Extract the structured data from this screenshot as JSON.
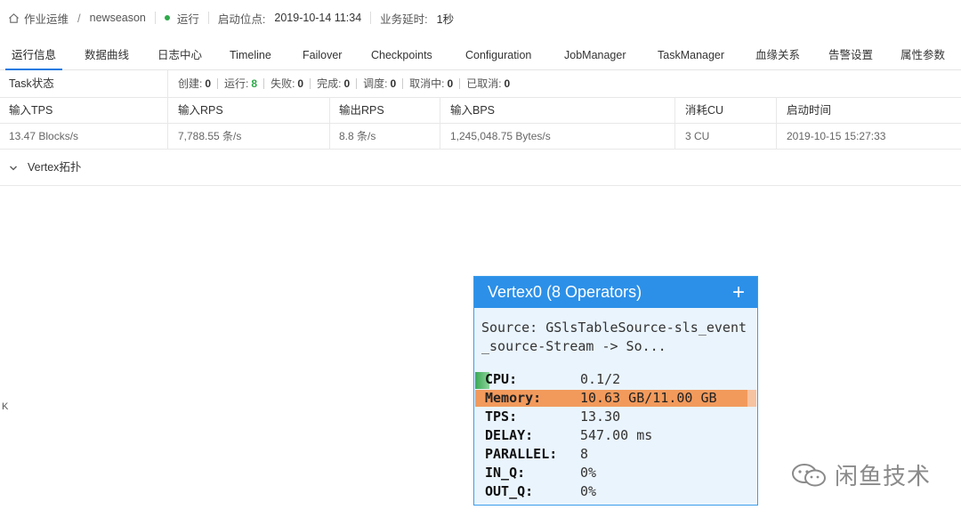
{
  "breadcrumb": {
    "root": "作业运维",
    "separator": "/",
    "job_name": "newseason",
    "status": "运行",
    "status_color": "#2eaa4a",
    "start_label": "启动位点:",
    "start_value": "2019-10-14 11:34",
    "delay_label": "业务延时:",
    "delay_value": "1秒"
  },
  "tabs": [
    {
      "label": "运行信息",
      "active": true
    },
    {
      "label": "数据曲线"
    },
    {
      "label": "日志中心"
    },
    {
      "label": "Timeline"
    },
    {
      "label": "Failover"
    },
    {
      "label": "Checkpoints"
    },
    {
      "label": "Configuration"
    },
    {
      "label": "JobManager"
    },
    {
      "label": "TaskManager"
    },
    {
      "label": "血缘关系"
    },
    {
      "label": "告警设置"
    },
    {
      "label": "属性参数"
    }
  ],
  "task_status": {
    "label": "Task状态",
    "items": [
      {
        "label": "创建:",
        "value": "0"
      },
      {
        "label": "运行:",
        "value": "8"
      },
      {
        "label": "失败:",
        "value": "0"
      },
      {
        "label": "完成:",
        "value": "0"
      },
      {
        "label": "调度:",
        "value": "0"
      },
      {
        "label": "取消中:",
        "value": "0"
      },
      {
        "label": "已取消:",
        "value": "0"
      }
    ]
  },
  "metrics_table": {
    "headers": [
      "输入TPS",
      "输入RPS",
      "输出RPS",
      "输入BPS",
      "消耗CU",
      "启动时间"
    ],
    "values": [
      "13.47 Blocks/s",
      "7,788.55 条/s",
      "8.8 条/s",
      "1,245,048.75 Bytes/s",
      "3 CU",
      "2019-10-15 15:27:33"
    ]
  },
  "vertex_section": {
    "title": "Vertex拓扑",
    "left_marker": "K"
  },
  "vertex": {
    "title": "Vertex0 (8 Operators)",
    "plus": "+",
    "source": "Source: GSlsTableSource-sls_event_source-Stream -> So...",
    "metrics": [
      {
        "key": "CPU:",
        "value": "0.1/2"
      },
      {
        "key": "Memory:",
        "value": "10.63 GB/11.00 GB"
      },
      {
        "key": "TPS:",
        "value": "13.30"
      },
      {
        "key": "DELAY:",
        "value": "547.00 ms"
      },
      {
        "key": "PARALLEL:",
        "value": "8"
      },
      {
        "key": "IN_Q:",
        "value": "0%"
      },
      {
        "key": "OUT_Q:",
        "value": "0%"
      }
    ],
    "accent_color": "#2c90e8",
    "memory_color": "#f29a5c"
  },
  "watermark": {
    "text": "闲鱼技术"
  }
}
